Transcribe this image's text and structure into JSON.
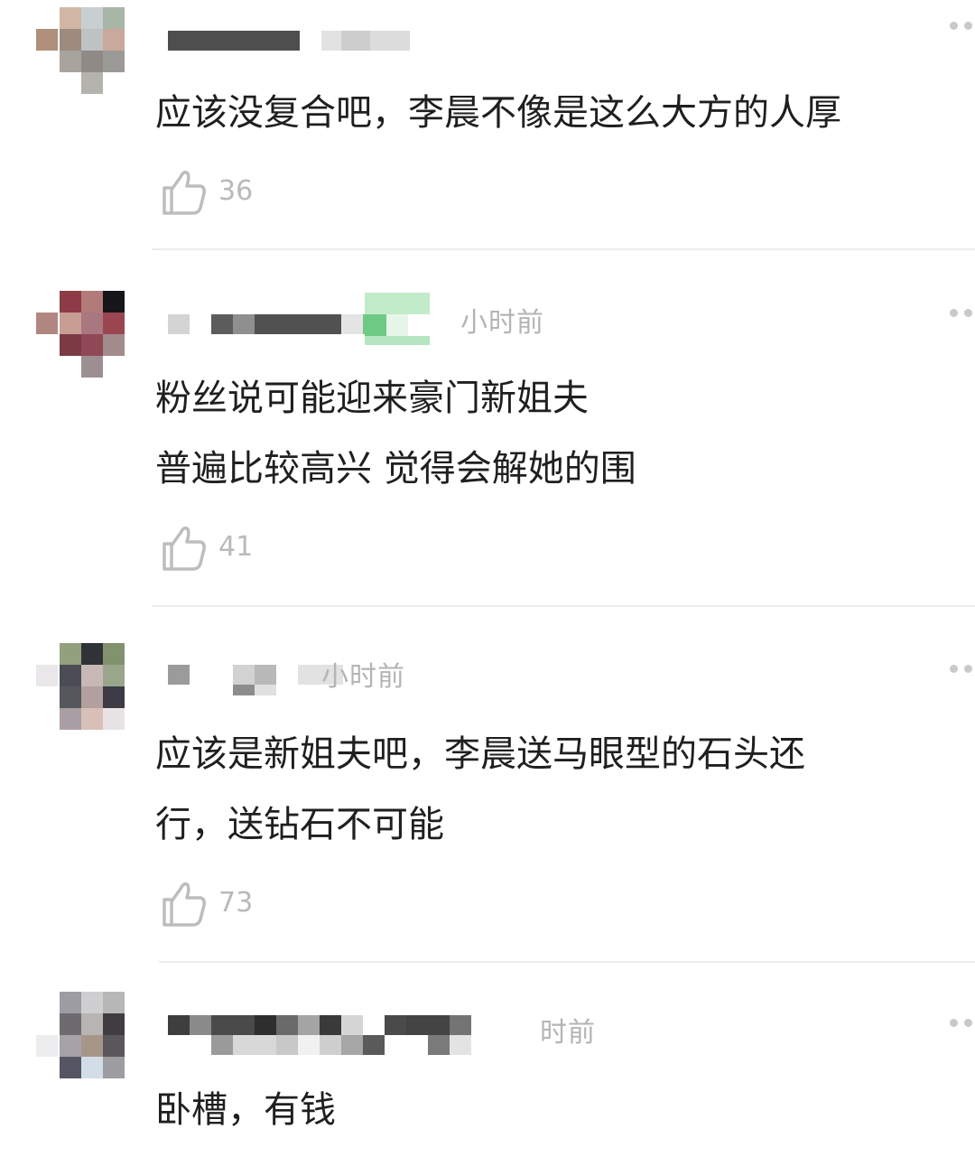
{
  "comments": [
    {
      "text_lines": [
        "应该没复合吧，李晨不像是这么大方的人厚"
      ],
      "time": "",
      "likes": "36",
      "avatar_colors": [
        "#d2b6a4",
        "#c7cfd1",
        "#a7b6a6",
        "#b08f7b",
        "#9d8b7e",
        "#bfc2c3",
        "#c9a99c",
        "#a8a49d",
        "#8f8a86",
        "#9c9a97",
        "#b5b3ae"
      ]
    },
    {
      "text_lines": [
        "粉丝说可能迎来豪门新姐夫",
        "普遍比较高兴 觉得会解她的围"
      ],
      "time": "小时前",
      "likes": "41",
      "avatar_colors": [
        "#8d3c47",
        "#b07b78",
        "#16161a",
        "#b18681",
        "#c89d94",
        "#a97780",
        "#9a4650",
        "#7a3b45",
        "#8f4856",
        "#a28a8d",
        "#9d8f91"
      ]
    },
    {
      "text_lines": [
        "应该是新姐夫吧，李晨送马眼型的石头还",
        "行，送钻石不可能"
      ],
      "time": "小时前",
      "likes": "73",
      "avatar_colors": [
        "#93a07e",
        "#2f3237",
        "#83926e",
        "#4a4d55",
        "#c7b7b5",
        "#9aa68c",
        "#54575c",
        "#b2a09f",
        "#3c3a45",
        "#a99fa4",
        "#d8c0b8",
        "#e8e4e6"
      ]
    },
    {
      "text_lines": [
        "卧槽，有钱"
      ],
      "time": "时前",
      "likes": "",
      "avatar_colors": [
        "#9e9ca3",
        "#cfcfd1",
        "#b7b7b8",
        "#6f6a6e",
        "#b8b4b1",
        "#3f3c42",
        "#a6a3a6",
        "#a79688",
        "#5a575c",
        "#545664",
        "#d3dde7",
        "#9c9ca1"
      ]
    }
  ]
}
